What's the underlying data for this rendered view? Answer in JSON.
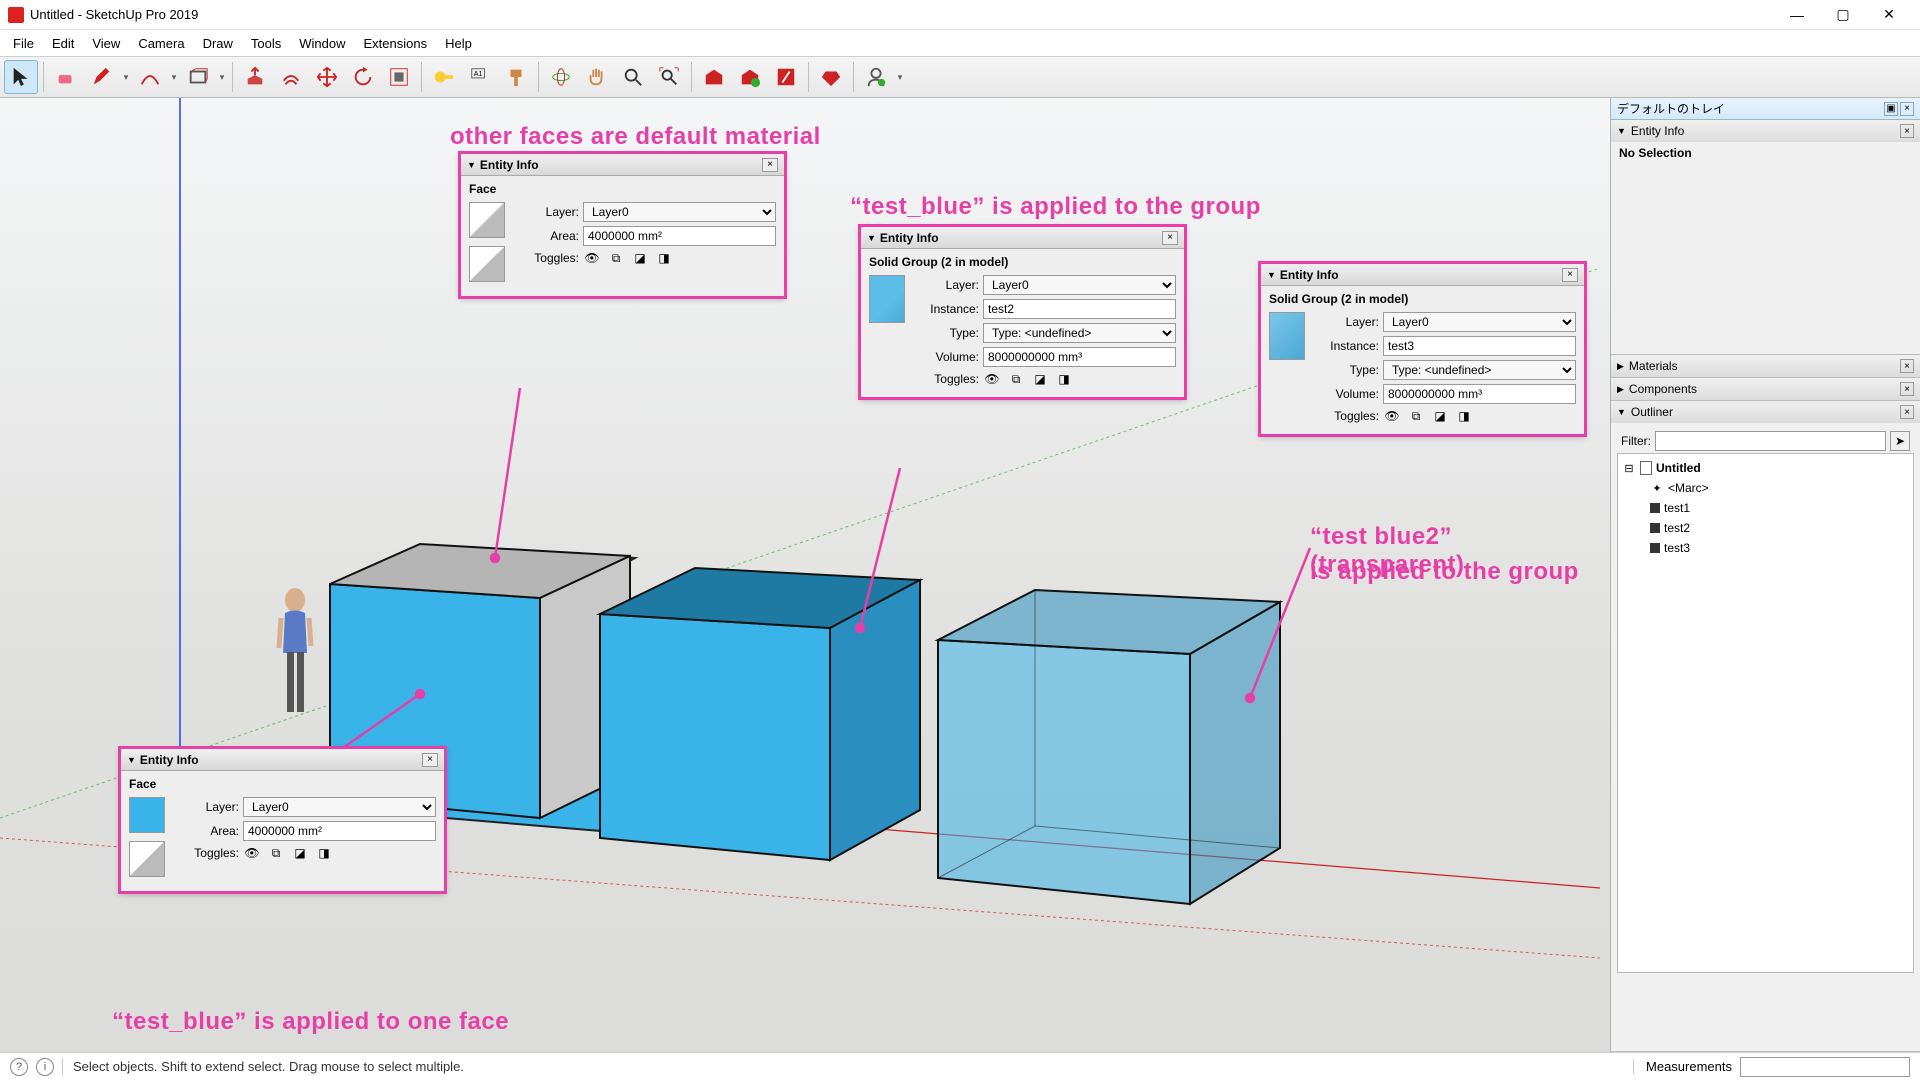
{
  "window": {
    "title": "Untitled - SketchUp Pro 2019"
  },
  "menu": [
    "File",
    "Edit",
    "View",
    "Camera",
    "Draw",
    "Tools",
    "Window",
    "Extensions",
    "Help"
  ],
  "status": {
    "hint": "Select objects. Shift to extend select. Drag mouse to select multiple.",
    "measurements_label": "Measurements"
  },
  "tray": {
    "title": "デフォルトのトレイ",
    "entity_info_title": "Entity Info",
    "no_selection": "No Selection",
    "sections": {
      "materials": "Materials",
      "components": "Components",
      "outliner": "Outliner"
    },
    "outliner": {
      "filter_label": "Filter:",
      "root": "Untitled",
      "items": [
        "<Marc>",
        "test1",
        "test2",
        "test3"
      ]
    }
  },
  "annotations": {
    "top": "other faces are default material",
    "mid": "“test_blue” is applied to the group",
    "right1": "“test blue2” (transparent)",
    "right2": "is applied to the group",
    "bottom": "“test_blue” is applied to one face"
  },
  "panels": {
    "p1": {
      "title": "Entity Info",
      "subtitle": "Face",
      "layer_label": "Layer:",
      "layer": "Layer0",
      "area_label": "Area:",
      "area": "4000000 mm²",
      "toggles_label": "Toggles:"
    },
    "p2": {
      "title": "Entity Info",
      "subtitle": "Face",
      "layer_label": "Layer:",
      "layer": "Layer0",
      "area_label": "Area:",
      "area": "4000000 mm²",
      "toggles_label": "Toggles:"
    },
    "p3": {
      "title": "Entity Info",
      "subtitle": "Solid Group (2 in model)",
      "layer_label": "Layer:",
      "layer": "Layer0",
      "instance_label": "Instance:",
      "instance": "test2",
      "type_label": "Type:",
      "type": "Type: <undefined>",
      "volume_label": "Volume:",
      "volume": "8000000000 mm³",
      "toggles_label": "Toggles:"
    },
    "p4": {
      "title": "Entity Info",
      "subtitle": "Solid Group (2 in model)",
      "layer_label": "Layer:",
      "layer": "Layer0",
      "instance_label": "Instance:",
      "instance": "test3",
      "type_label": "Type:",
      "type": "Type: <undefined>",
      "volume_label": "Volume:",
      "volume": "8000000000 mm³",
      "toggles_label": "Toggles:"
    }
  },
  "colors": {
    "accent": "#e63fa8",
    "blue": "#3ab3e8",
    "blue_dark": "#2a8fc0",
    "blue_top": "#1f7aa3"
  }
}
